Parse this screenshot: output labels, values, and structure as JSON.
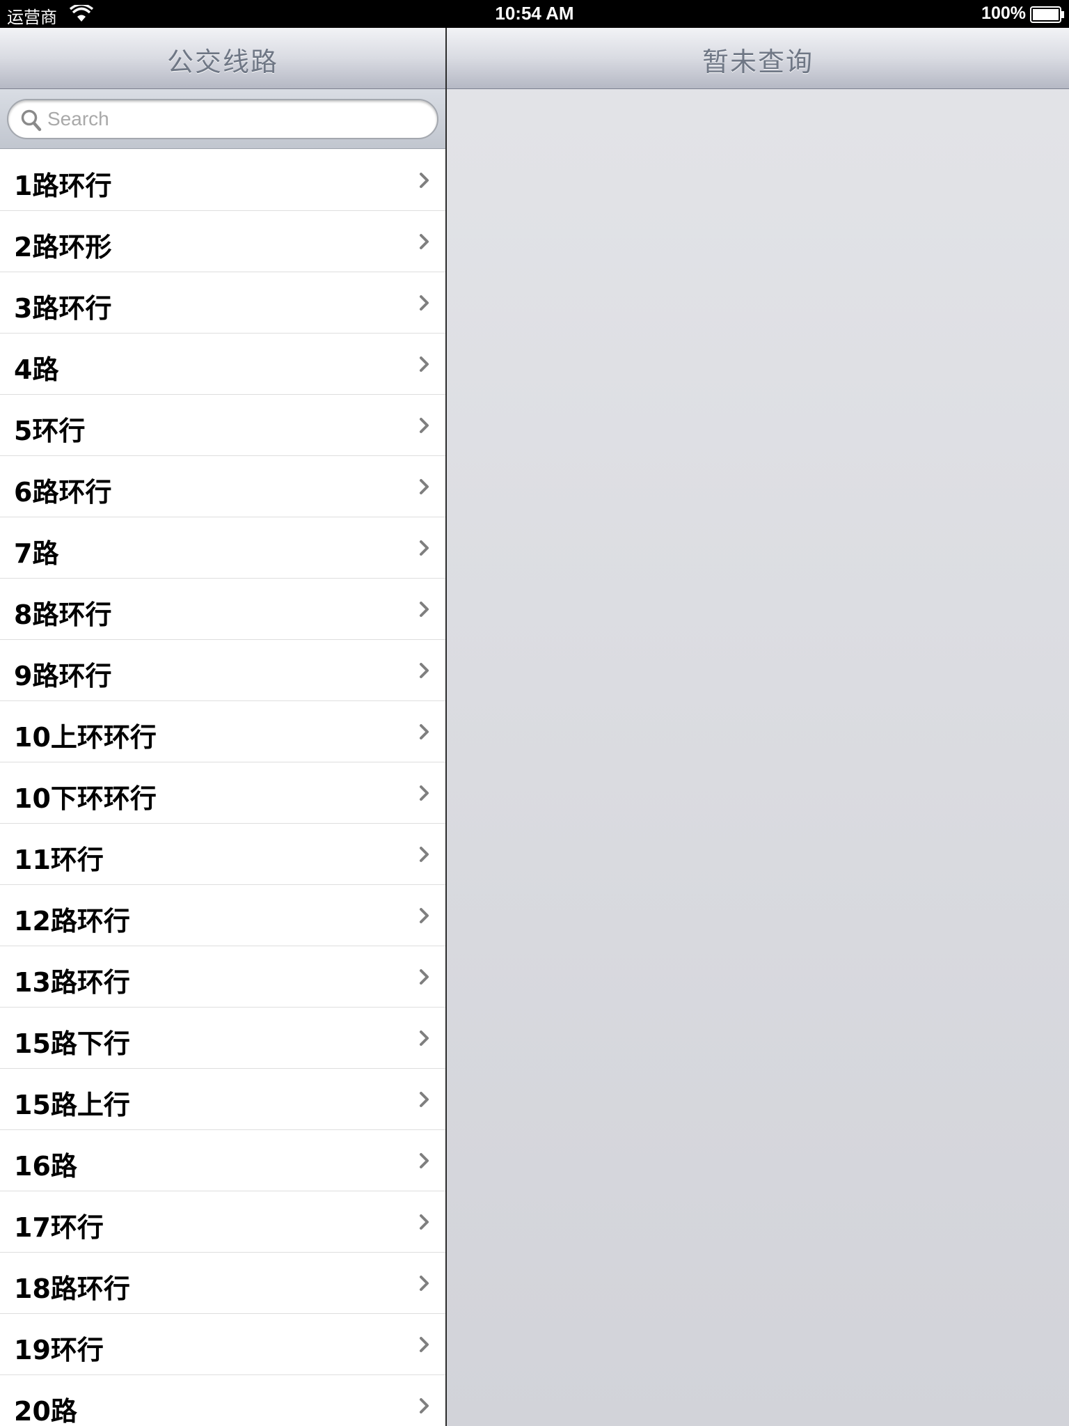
{
  "status_bar": {
    "carrier": "运营商",
    "time": "10:54 AM",
    "battery": "100%"
  },
  "master": {
    "title": "公交线路",
    "search": {
      "placeholder": "Search",
      "value": ""
    },
    "routes": [
      "1路环行",
      "2路环形",
      "3路环行",
      "4路",
      "5环行",
      "6路环行",
      "7路",
      "8路环行",
      "9路环行",
      "10上环环行",
      "10下环环行",
      "11环行",
      "12路环行",
      "13路环行",
      "15路下行",
      "15路上行",
      "16路",
      "17环行",
      "18路环行",
      "19环行",
      "20路"
    ]
  },
  "detail": {
    "title": "暂未查询"
  },
  "icons": {
    "wifi": "wifi-icon",
    "battery": "battery-icon",
    "search": "search-icon",
    "chevron": "chevron-right-icon"
  },
  "colors": {
    "nav_title": "#6f7785",
    "chevron": "#7f7f7f",
    "detail_bg": "#dcdde2"
  }
}
